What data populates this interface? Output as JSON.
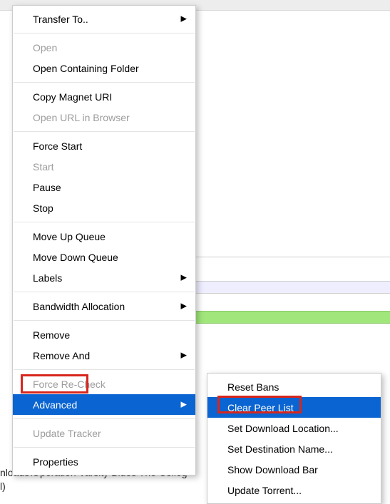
{
  "background": {
    "path_fragment": "nloads\\Operation Varsity Blues The Colleg",
    "trailing": "l)"
  },
  "main_menu": {
    "transfer_to": "Transfer To..",
    "open": "Open",
    "open_containing_folder": "Open Containing Folder",
    "copy_magnet_uri": "Copy Magnet URI",
    "open_url_in_browser": "Open URL in Browser",
    "force_start": "Force Start",
    "start": "Start",
    "pause": "Pause",
    "stop": "Stop",
    "move_up_queue": "Move Up Queue",
    "move_down_queue": "Move Down Queue",
    "labels": "Labels",
    "bandwidth_allocation": "Bandwidth Allocation",
    "remove": "Remove",
    "remove_and": "Remove And",
    "force_recheck": "Force Re-Check",
    "advanced": "Advanced",
    "update_tracker": "Update Tracker",
    "properties": "Properties"
  },
  "sub_menu": {
    "reset_bans": "Reset Bans",
    "clear_peer_list": "Clear Peer List",
    "set_download_location": "Set Download Location...",
    "set_destination_name": "Set Destination Name...",
    "show_download_bar": "Show Download Bar",
    "update_torrent": "Update Torrent..."
  }
}
